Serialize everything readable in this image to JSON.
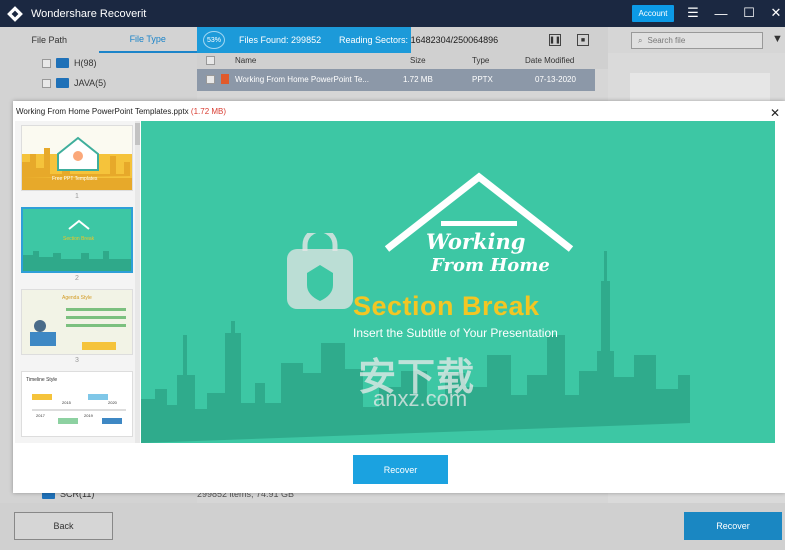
{
  "app": {
    "title": "Wondershare Recoverit",
    "account_label": "Account",
    "controls": {
      "menu": "☰",
      "minimize": "—",
      "maximize": "☐",
      "close": "✕"
    }
  },
  "left": {
    "tabs": [
      {
        "label": "File Path"
      },
      {
        "label": "File Type"
      }
    ],
    "active_tab": "File Type",
    "items": [
      {
        "label": "H(98)"
      },
      {
        "label": "JAVA(5)"
      }
    ],
    "bottom_item": "SCR(11)"
  },
  "scan": {
    "percent": "53%",
    "files_found_label": "Files Found:",
    "files_found": "299852",
    "sectors_label": "Reading Sectors:",
    "sectors": "16482304/250064896"
  },
  "search": {
    "placeholder": "Search file"
  },
  "table": {
    "headers": {
      "name": "Name",
      "size": "Size",
      "type": "Type",
      "date": "Date Modified"
    },
    "row": {
      "name": "Working From Home PowerPoint Te...",
      "size": "1.72 MB",
      "type": "PPTX",
      "date": "07-13-2020"
    }
  },
  "status": {
    "text": "299852 items, 74.91 GB"
  },
  "buttons": {
    "back": "Back",
    "recover": "Recover"
  },
  "preview": {
    "filename": "Working From Home PowerPoint Templates.pptx",
    "filesize": "(1.72 MB)",
    "close": "✕",
    "recover": "Recover",
    "slide": {
      "title_line1": "Working",
      "title_line2": "From Home",
      "section": "Section Break",
      "subtitle": "Insert the Subtitle of Your Presentation"
    },
    "thumbnails": [
      {
        "number": "1",
        "caption": "Free PPT Templates"
      },
      {
        "number": "2",
        "caption": "Section Break"
      },
      {
        "number": "3",
        "caption": "Agenda Style"
      },
      {
        "number": "",
        "caption": "Timeline Style"
      }
    ],
    "timeline_years": [
      "2015",
      "2020",
      "2017",
      "2019"
    ]
  },
  "watermark": {
    "text": "安下载",
    "url": "anxz.com"
  },
  "colors": {
    "titlebar": "#1b2841",
    "accent": "#1c9ad9",
    "slide_bg": "#3dc7a4",
    "section_text": "#f3c623",
    "size_red": "#d93d32"
  }
}
